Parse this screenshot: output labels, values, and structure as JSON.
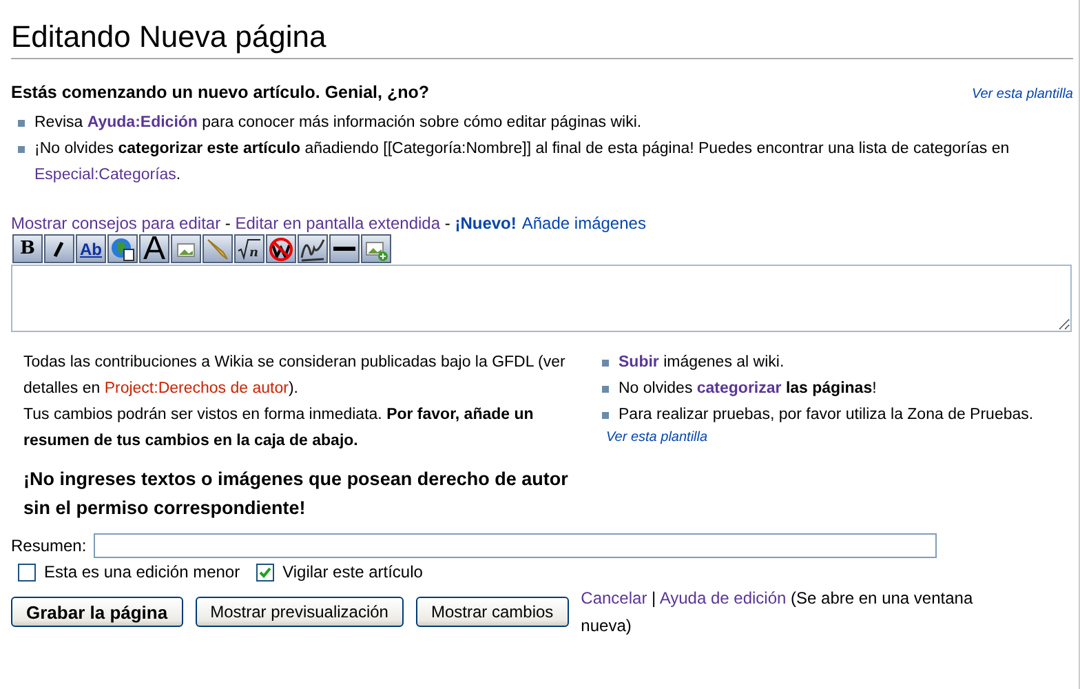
{
  "title": "Editando Nueva página",
  "intro": {
    "heading": "Estás comenzando un nuevo artículo. Genial, ¿no?",
    "template_link": "Ver esta plantilla",
    "bullets": [
      [
        {
          "kind": "text",
          "text": "Revisa "
        },
        {
          "kind": "link",
          "text": "Ayuda:Edición",
          "bold": true
        },
        {
          "kind": "text",
          "text": " para conocer más información sobre cómo editar páginas wiki."
        }
      ],
      [
        {
          "kind": "text",
          "text": "¡No olvides **categorizar este artículo** añadiendo [[Categoría:Nombre]] al final de esta página! Puedes encontrar una lista de categorías en "
        },
        {
          "kind": "link",
          "text": "Especial:Categorías",
          "bold": false
        },
        {
          "kind": "text",
          "text": "."
        }
      ]
    ]
  },
  "edit_links": [
    {
      "kind": "link",
      "text": "Mostrar consejos para editar"
    },
    {
      "kind": "sep",
      "text": " - "
    },
    {
      "kind": "link",
      "text": "Editar en pantalla extendida"
    },
    {
      "kind": "sep",
      "text": " - "
    },
    {
      "kind": "new",
      "text": "¡Nuevo!"
    },
    {
      "kind": "link2",
      "text": "Añade imágenes"
    }
  ],
  "toolbar": [
    {
      "kind": "bold",
      "label": "B"
    },
    {
      "kind": "italic"
    },
    {
      "kind": "link",
      "label": "Ab"
    },
    {
      "kind": "globe"
    },
    {
      "kind": "headline",
      "label": "A"
    },
    {
      "kind": "image"
    },
    {
      "kind": "media"
    },
    {
      "kind": "math",
      "label": "n"
    },
    {
      "kind": "nowiki"
    },
    {
      "kind": "signature"
    },
    {
      "kind": "rule"
    },
    {
      "kind": "gallery"
    }
  ],
  "license": {
    "line1": [
      {
        "kind": "text",
        "text": "Todas las contribuciones a Wikia se consideran publicadas bajo la GFDL (ver detalles en "
      },
      {
        "kind": "redlink",
        "text": "Project:Derechos de autor"
      },
      {
        "kind": "text",
        "text": ")."
      }
    ],
    "line2": "Tus cambios podrán ser vistos en forma inmediata. **Por favor, añade un resumen de tus cambios en la caja de abajo.**",
    "warning": "¡No ingreses textos o imágenes que posean derecho de autor sin el permiso correspondiente!"
  },
  "side": {
    "bullets": [
      [
        {
          "kind": "link",
          "text": "Subir",
          "bold": true
        },
        {
          "kind": "text",
          "text": " imágenes al wiki."
        }
      ],
      [
        {
          "kind": "text",
          "text": "No olvides "
        },
        {
          "kind": "link",
          "text": "categorizar",
          "bold": true
        },
        {
          "kind": "text",
          "text": " **las páginas**!"
        }
      ],
      [
        {
          "kind": "text",
          "text": "Para realizar pruebas, por favor utiliza la Zona de Pruebas."
        }
      ]
    ],
    "template_link": "Ver esta plantilla"
  },
  "summary": {
    "label": "Resumen:"
  },
  "options": [
    {
      "label": "Esta es una edición menor",
      "checked": false
    },
    {
      "label": "Vigilar este artículo",
      "checked": true
    }
  ],
  "buttons": [
    {
      "label": "Grabar la página",
      "primary": true
    },
    {
      "label": "Mostrar previsualización",
      "primary": false
    },
    {
      "label": "Mostrar cambios",
      "primary": false
    }
  ],
  "footer": [
    {
      "kind": "link",
      "text": "Cancelar"
    },
    {
      "kind": "text",
      "text": " | "
    },
    {
      "kind": "link",
      "text": "Ayuda de edición"
    },
    {
      "kind": "text",
      "text": " (Se abre en una ventana nueva)"
    }
  ]
}
